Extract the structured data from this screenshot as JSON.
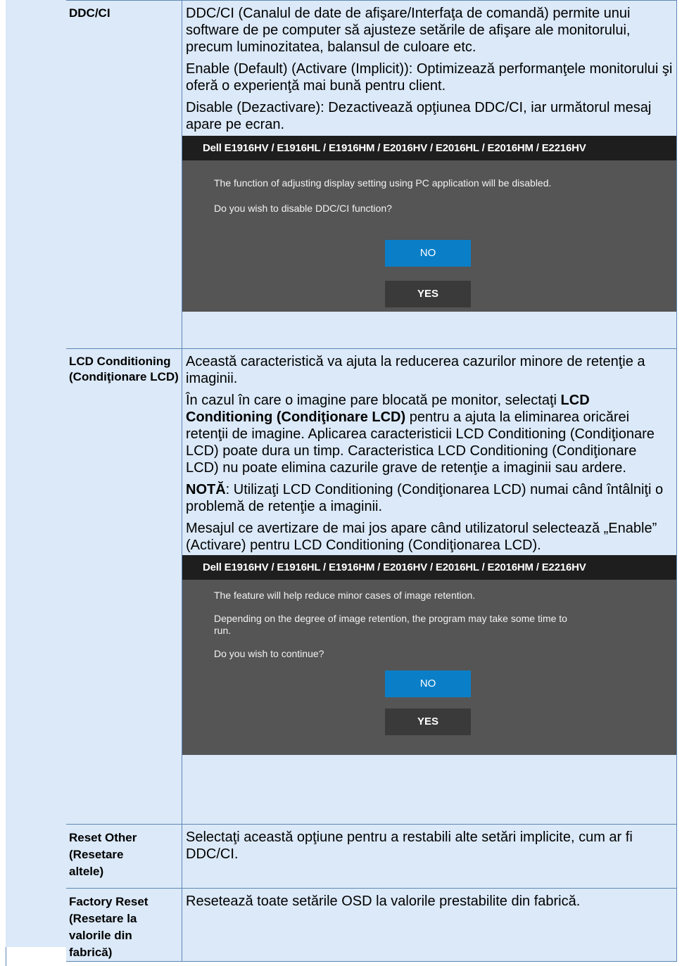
{
  "rows": {
    "ddc": {
      "label": "DDC/CI",
      "description": [
        "DDC/CI (Canalul de date de afişare/Interfaţa de comandă) permite unui software de pe computer să ajusteze setările de afişare ale monitorului, precum luminozitatea, balansul de culoare etc.",
        "Enable (Default) (Activare (Implicit)): Optimizează performanţele monitorului şi oferă o experienţă mai bună pentru client.",
        "Disable (Dezactivare): Dezactivează opţiunea DDC/CI, iar următorul mesaj apare pe ecran."
      ],
      "dialog": {
        "title": "Dell E1916HV / E1916HL / E1916HM / E2016HV / E2016HL / E2016HM / E2216HV",
        "messages": [
          "The function of adjusting display setting using PC application will be disabled.",
          "Do you wish to disable DDC/CI function?"
        ],
        "no_label": "NO",
        "yes_label": "YES"
      }
    },
    "lcd": {
      "label": "LCD Conditioning (Condiţionare LCD)",
      "description": [
        "Această caracteristică va ajuta la reducerea cazurilor minore de retenţie a imaginii.",
        "În cazul în care o imagine pare blocată pe monitor, selectaţi",
        "LCD Conditioning (Condiţionare LCD)",
        "pentru a ajuta la eliminarea oricărei retenţii de imagine. Aplicarea caracteristicii LCD Conditioning (Condiţionare LCD) poate dura un timp. Caracteristica LCD Conditioning (Condiţionare LCD) nu poate elimina cazurile grave de retenţie a imaginii sau ardere.",
        "NOTĂ",
        ": Utilizaţi LCD Conditioning (Condiţionarea LCD) numai când întâlniţi o problemă de retenţie a imaginii.",
        "Mesajul ce avertizare de mai jos apare când utilizatorul selectează „Enable” (Activare) pentru LCD Conditioning (Condiţionarea LCD)."
      ],
      "dialog": {
        "title": "Dell E1916HV / E1916HL / E1916HM / E2016HV / E2016HL / E2016HM / E2216HV",
        "messages": [
          "The feature will help reduce minor cases of image retention.",
          "Depending on the degree of image retention, the program may take some time to run.",
          "Do you wish to continue?"
        ],
        "no_label": "NO",
        "yes_label": "YES"
      }
    },
    "reset_other": {
      "label": "Reset Other (Resetare altele)",
      "description": "Selectaţi această opţiune pentru a restabili alte setări implicite, cum ar fi DDC/CI."
    },
    "factory_reset": {
      "label": "Factory Reset (Resetare la valorile din fabrică)",
      "description": "Resetează toate setările OSD la valorile prestabilite din fabrică."
    }
  }
}
